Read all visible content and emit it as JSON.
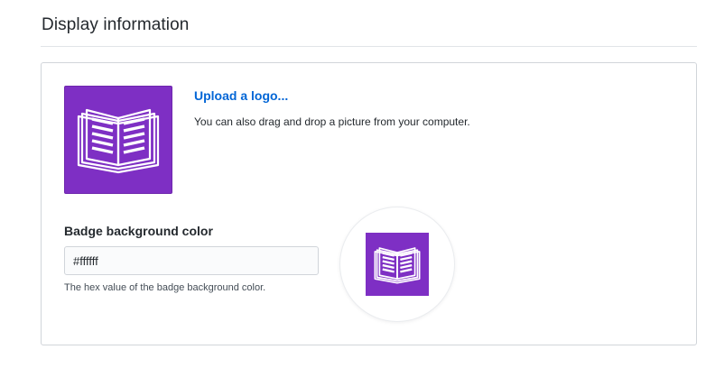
{
  "section": {
    "title": "Display information"
  },
  "logo": {
    "icon": "open-book-icon",
    "background_color": "#7e2fc4",
    "upload_label": "Upload a logo...",
    "help_text": "You can also drag and drop a picture from your computer."
  },
  "badge": {
    "label": "Badge background color",
    "value": "#ffffff",
    "help_text": "The hex value of the badge background color.",
    "preview_icon": "open-book-icon"
  },
  "colors": {
    "link": "#0366d6",
    "brand_purple": "#7e2fc4",
    "border": "#d1d5da"
  }
}
